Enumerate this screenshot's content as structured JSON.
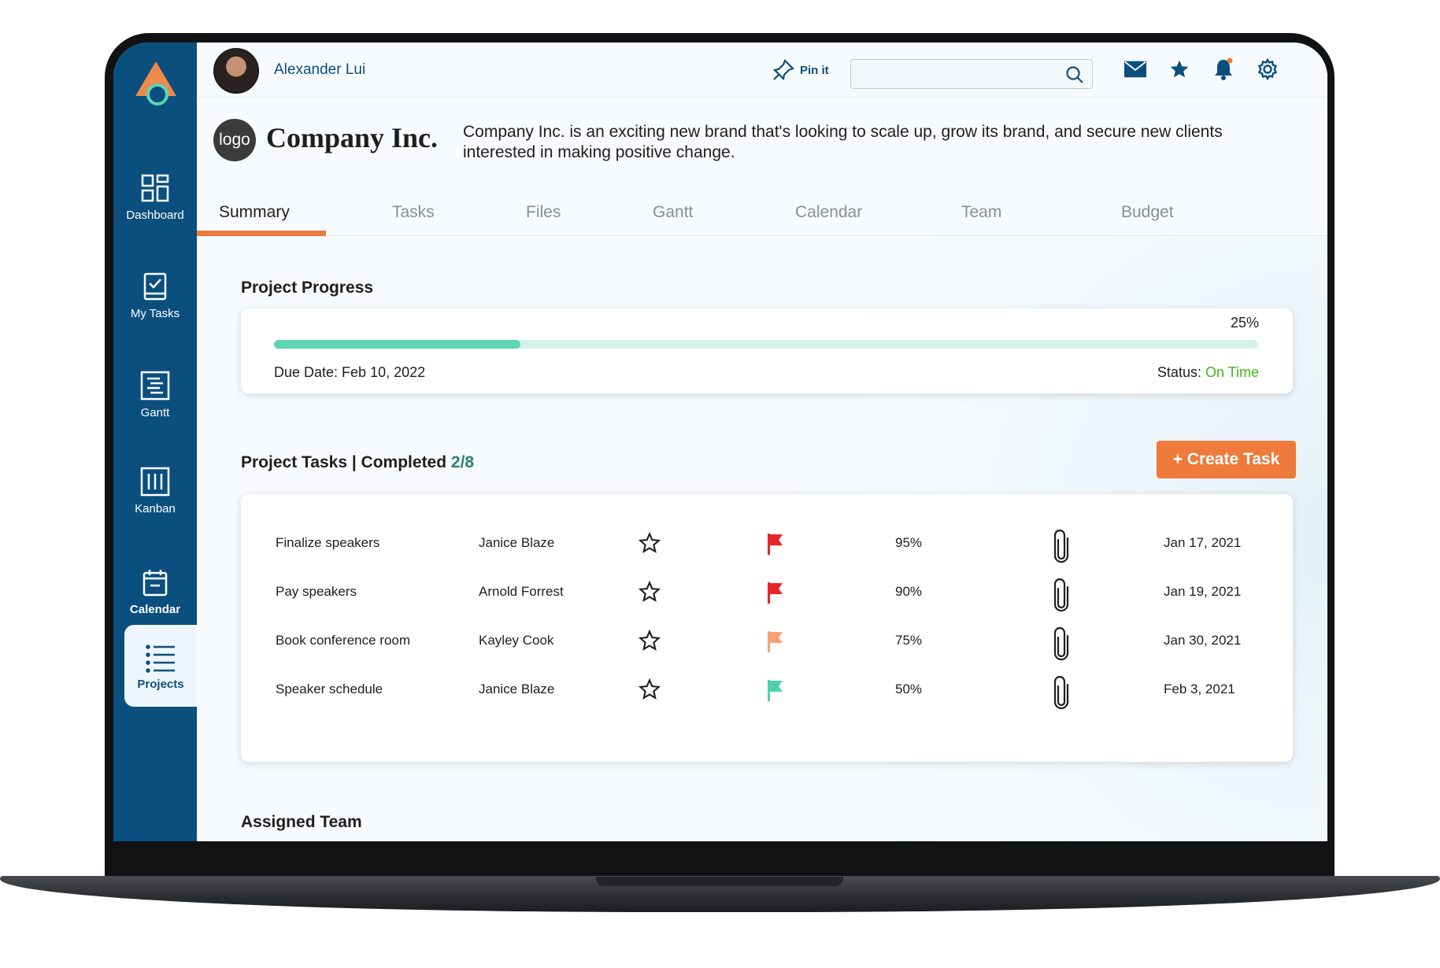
{
  "header": {
    "user_name": "Alexander Lui",
    "pin_label": "Pin it",
    "search_placeholder": ""
  },
  "sidebar": {
    "items": [
      {
        "label": "Dashboard",
        "icon": "dashboard-icon"
      },
      {
        "label": "My Tasks",
        "icon": "task-check-icon"
      },
      {
        "label": "Gantt",
        "icon": "gantt-icon"
      },
      {
        "label": "Kanban",
        "icon": "kanban-icon"
      },
      {
        "label": "Calendar",
        "icon": "calendar-icon"
      },
      {
        "label": "Projects",
        "icon": "list-icon",
        "active": true
      }
    ]
  },
  "company": {
    "logo_text": "logo",
    "name": "Company Inc.",
    "description": "Company Inc. is an exciting new brand that's looking to scale up, grow its brand, and secure new clients interested in making positive change."
  },
  "tabs": [
    "Summary",
    "Tasks",
    "Files",
    "Gantt",
    "Calendar",
    "Team",
    "Budget"
  ],
  "progress": {
    "title": "Project Progress",
    "percent_label": "25%",
    "percent": 25,
    "due_date": "Due Date: Feb 10, 2022",
    "status_label": "Status:",
    "status_value": "On Time"
  },
  "tasks": {
    "title": "Project Tasks | Completed",
    "completed": "2/8",
    "create_label": "+ Create Task",
    "rows": [
      {
        "name": "Finalize speakers",
        "assignee": "Janice Blaze",
        "flag_color": "#e8232a",
        "percent": "95%",
        "date": "Jan 17, 2021"
      },
      {
        "name": "Pay speakers",
        "assignee": "Arnold Forrest",
        "flag_color": "#e8232a",
        "percent": "90%",
        "date": "Jan 19, 2021"
      },
      {
        "name": "Book conference room",
        "assignee": "Kayley Cook",
        "flag_color": "#f5a478",
        "percent": "75%",
        "date": "Jan 30, 2021"
      },
      {
        "name": "Speaker schedule",
        "assignee": "Janice Blaze",
        "flag_color": "#4fd1b0",
        "percent": "50%",
        "date": "Feb 3, 2021"
      }
    ]
  },
  "team": {
    "title": "Assigned Team"
  },
  "colors": {
    "sidebar": "#0b4f7f",
    "accent": "#ee7a3b",
    "progress": "#5dd4b4",
    "status_ok": "#46b31e"
  }
}
